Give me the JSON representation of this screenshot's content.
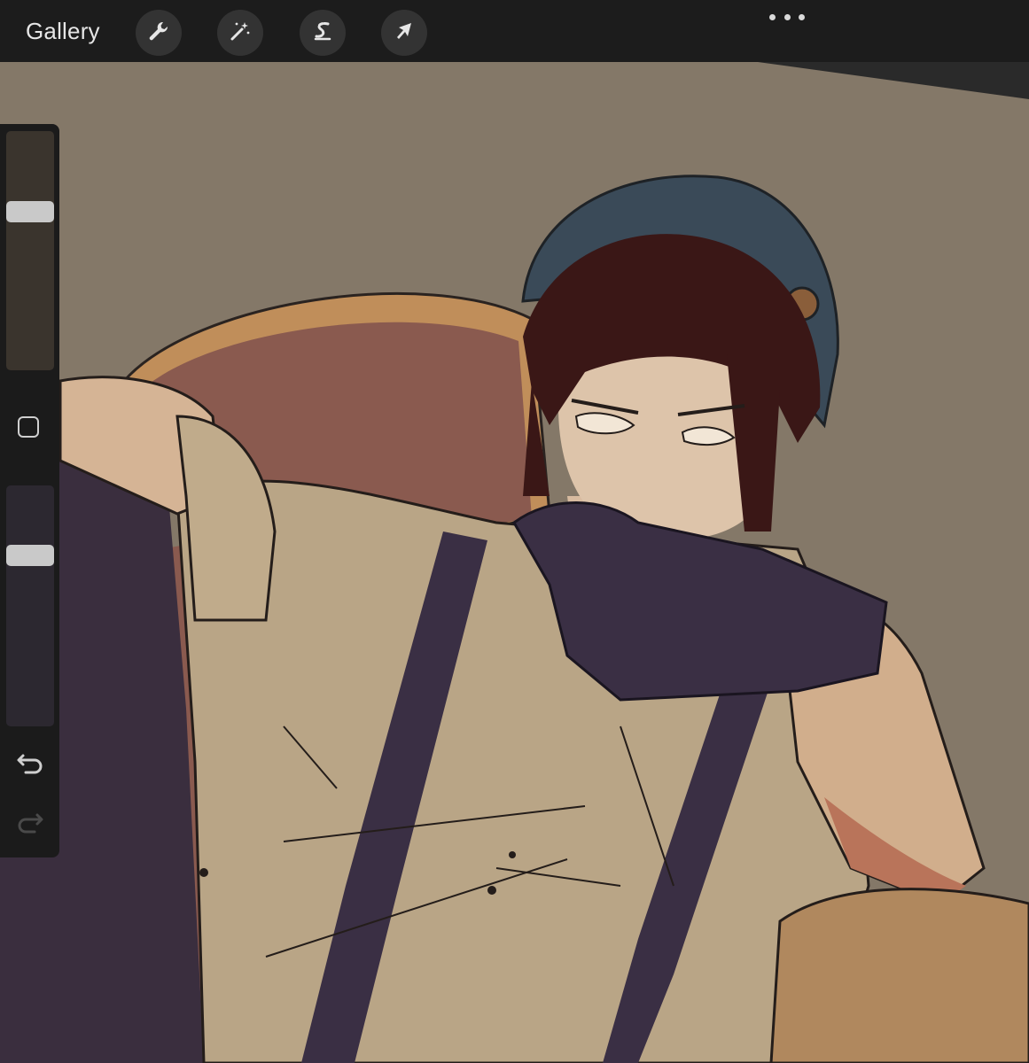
{
  "topbar": {
    "gallery_label": "Gallery",
    "tools": [
      {
        "name": "actions",
        "icon": "wrench-icon"
      },
      {
        "name": "adjustments",
        "icon": "magic-wand-icon"
      },
      {
        "name": "selection",
        "icon": "selection-s-icon"
      },
      {
        "name": "transform",
        "icon": "arrow-cursor-icon"
      }
    ],
    "more_icon": "ellipsis-icon"
  },
  "sidebar": {
    "brush_size_level": 0.68,
    "opacity_level": 0.73,
    "modify_icon": "square-icon",
    "undo_icon": "undo-icon",
    "redo_icon": "redo-icon",
    "redo_enabled": false
  },
  "colors": {
    "topbar_bg": "#1c1c1c",
    "tool_button_bg": "#333333",
    "canvas_wall": "#847868",
    "sidebar_bg": "#1b1b1b",
    "slider_thumb": "#c9c9c9"
  }
}
